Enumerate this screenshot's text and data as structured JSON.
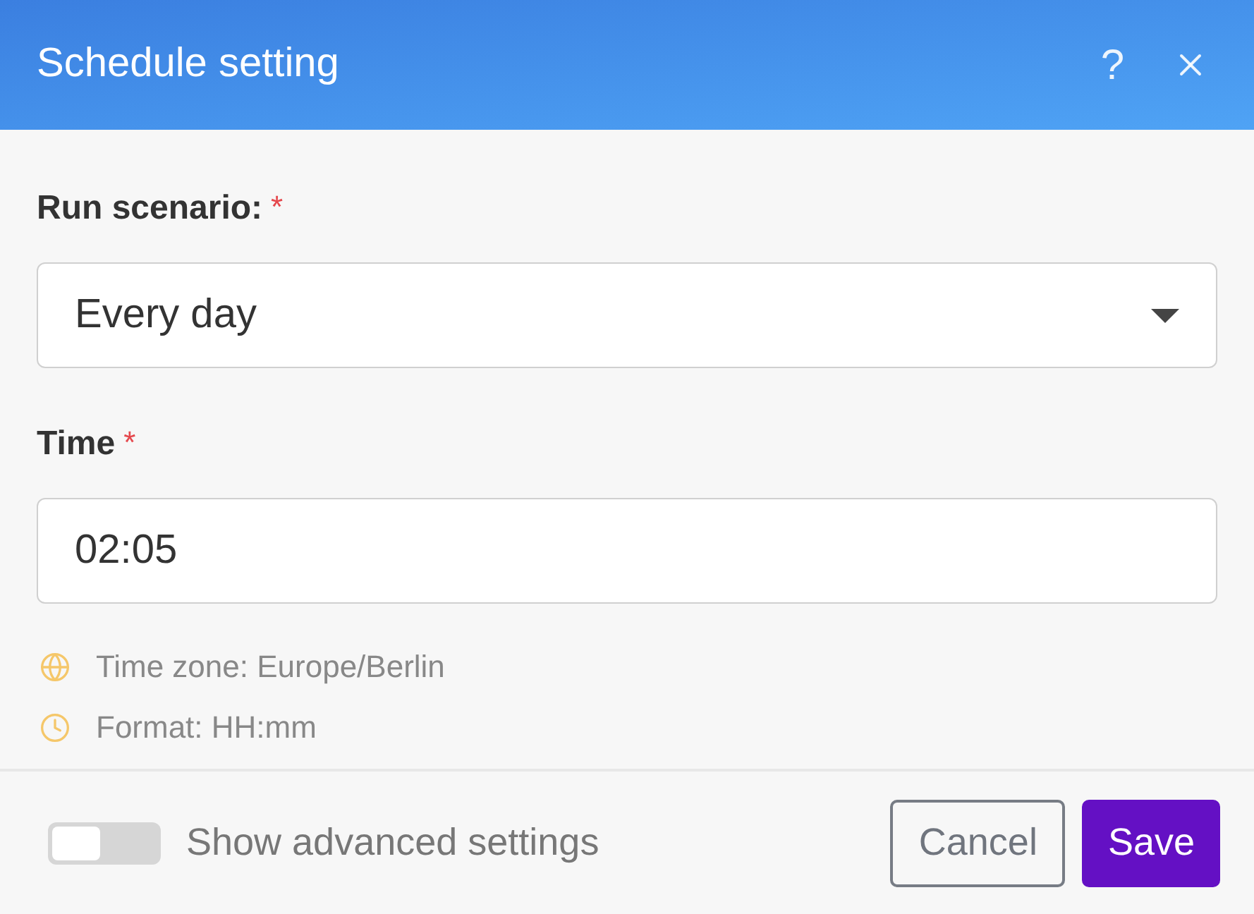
{
  "dialog": {
    "title": "Schedule setting",
    "help": "?"
  },
  "fields": [
    {
      "kind": "select",
      "label": "Run scenario:",
      "required_mark": "*",
      "value": "Every day"
    },
    {
      "kind": "input",
      "label": "Time",
      "required_mark": "*",
      "value": "02:05"
    }
  ],
  "hints": [
    {
      "kind": "timezone",
      "text": "Time zone: Europe/Berlin"
    },
    {
      "kind": "format",
      "text": "Format: HH:mm"
    }
  ],
  "advanced_toggle": {
    "label": "Show advanced settings",
    "on": false
  },
  "buttons": [
    {
      "kind": "secondary",
      "label": "Cancel"
    },
    {
      "kind": "primary",
      "label": "Save"
    }
  ]
}
